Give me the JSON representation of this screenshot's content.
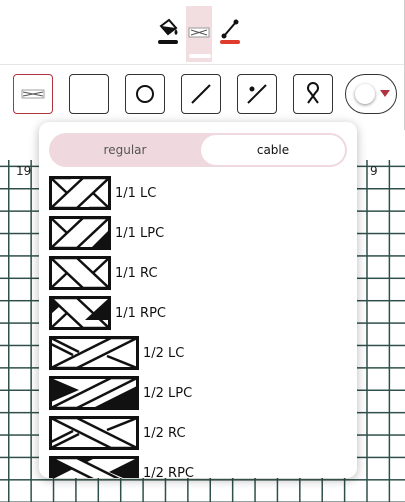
{
  "top_toolbar": {
    "tools": [
      {
        "name": "fill-bucket-icon"
      },
      {
        "name": "cable-tool-icon"
      },
      {
        "name": "line-tool-icon"
      }
    ],
    "underline_black": "#111111",
    "underline_red": "#e03a2f",
    "active_bg": "#f2dde1"
  },
  "symbol_tools": [
    {
      "name": "cable-symbol-icon"
    },
    {
      "name": "empty-square-icon"
    },
    {
      "name": "circle-icon"
    },
    {
      "name": "slash-icon"
    },
    {
      "name": "slash-dot-icon"
    },
    {
      "name": "loop-icon"
    }
  ],
  "color_picker": {
    "value": "#ffffff",
    "caret_color": "#b0343f"
  },
  "column_numbers": [
    "19",
    "9"
  ],
  "popup": {
    "tabs": {
      "regular": "regular",
      "cable": "cable",
      "selected": "cable"
    },
    "items": [
      {
        "label": "1/1 LC"
      },
      {
        "label": "1/1 LPC"
      },
      {
        "label": "1/1 RC"
      },
      {
        "label": "1/1 RPC"
      },
      {
        "label": "1/2 LC"
      },
      {
        "label": "1/2 LPC"
      },
      {
        "label": "1/2 RC"
      },
      {
        "label": "1/2 RPC"
      }
    ]
  },
  "colors": {
    "accent": "#b0343f",
    "grid": "#2f4f4a",
    "segment_bg": "#efd9de"
  }
}
